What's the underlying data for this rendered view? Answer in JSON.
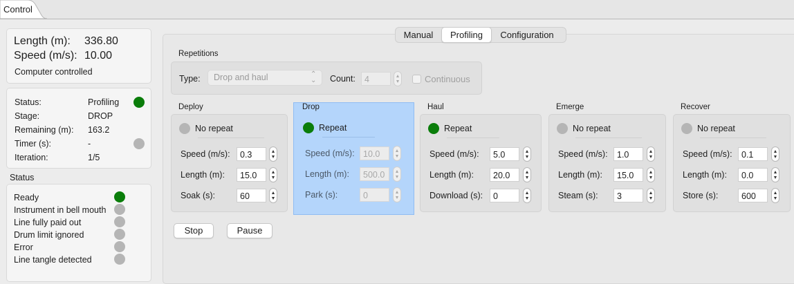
{
  "window": {
    "tab_label": "Control"
  },
  "summary": {
    "length_label": "Length (m):",
    "length_value": "336.80",
    "speed_label": "Speed (m/s):",
    "speed_value": "10.00",
    "mode": "Computer controlled"
  },
  "state": {
    "rows": [
      {
        "label": "Status:",
        "value": "Profiling",
        "indicator": "green"
      },
      {
        "label": "Stage:",
        "value": "DROP"
      },
      {
        "label": "Remaining (m):",
        "value": "163.2"
      },
      {
        "label": "Timer (s):",
        "value": "-",
        "indicator": "gray"
      },
      {
        "label": "Iteration:",
        "value": "1/5"
      }
    ]
  },
  "status": {
    "title": "Status",
    "items": [
      {
        "label": "Ready",
        "indicator": "green"
      },
      {
        "label": "Instrument in bell mouth",
        "indicator": "gray"
      },
      {
        "label": "Line fully paid out",
        "indicator": "gray"
      },
      {
        "label": "Drum limit ignored",
        "indicator": "gray"
      },
      {
        "label": "Error",
        "indicator": "gray"
      },
      {
        "label": "Line tangle detected",
        "indicator": "gray"
      }
    ]
  },
  "tabs": [
    {
      "label": "Manual",
      "selected": false
    },
    {
      "label": "Profiling",
      "selected": true
    },
    {
      "label": "Configuration",
      "selected": false
    }
  ],
  "repetitions": {
    "title": "Repetitions",
    "type_label": "Type:",
    "type_value": "Drop and haul",
    "count_label": "Count:",
    "count_value": "4",
    "continuous_label": "Continuous",
    "continuous_checked": false
  },
  "stages": [
    {
      "title": "Deploy",
      "repeat_label": "No repeat",
      "repeat_on": false,
      "highlighted": false,
      "fields": [
        {
          "label": "Speed (m/s):",
          "value": "0.3"
        },
        {
          "label": "Length (m):",
          "value": "15.0"
        },
        {
          "label": "Soak (s):",
          "value": "60"
        }
      ]
    },
    {
      "title": "Drop",
      "repeat_label": "Repeat",
      "repeat_on": true,
      "highlighted": true,
      "disabled": true,
      "fields": [
        {
          "label": "Speed (m/s):",
          "value": "10.0"
        },
        {
          "label": "Length (m):",
          "value": "500.0"
        },
        {
          "label": "Park (s):",
          "value": "0"
        }
      ]
    },
    {
      "title": "Haul",
      "repeat_label": "Repeat",
      "repeat_on": true,
      "highlighted": false,
      "fields": [
        {
          "label": "Speed (m/s):",
          "value": "5.0"
        },
        {
          "label": "Length (m):",
          "value": "20.0"
        },
        {
          "label": "Download (s):",
          "value": "0"
        }
      ]
    },
    {
      "title": "Emerge",
      "repeat_label": "No repeat",
      "repeat_on": false,
      "highlighted": false,
      "fields": [
        {
          "label": "Speed (m/s):",
          "value": "1.0"
        },
        {
          "label": "Length (m):",
          "value": "15.0"
        },
        {
          "label": "Steam (s):",
          "value": "3"
        }
      ]
    },
    {
      "title": "Recover",
      "repeat_label": "No repeat",
      "repeat_on": false,
      "highlighted": false,
      "fields": [
        {
          "label": "Speed (m/s):",
          "value": "0.1"
        },
        {
          "label": "Length (m):",
          "value": "0.0"
        },
        {
          "label": "Store (s):",
          "value": "600"
        }
      ]
    }
  ],
  "actions": {
    "stop_label": "Stop",
    "pause_label": "Pause"
  },
  "colors": {
    "indicator_green": "#0a7d0a",
    "indicator_gray": "#b5b5b5",
    "highlight": "#b4d5fb"
  }
}
